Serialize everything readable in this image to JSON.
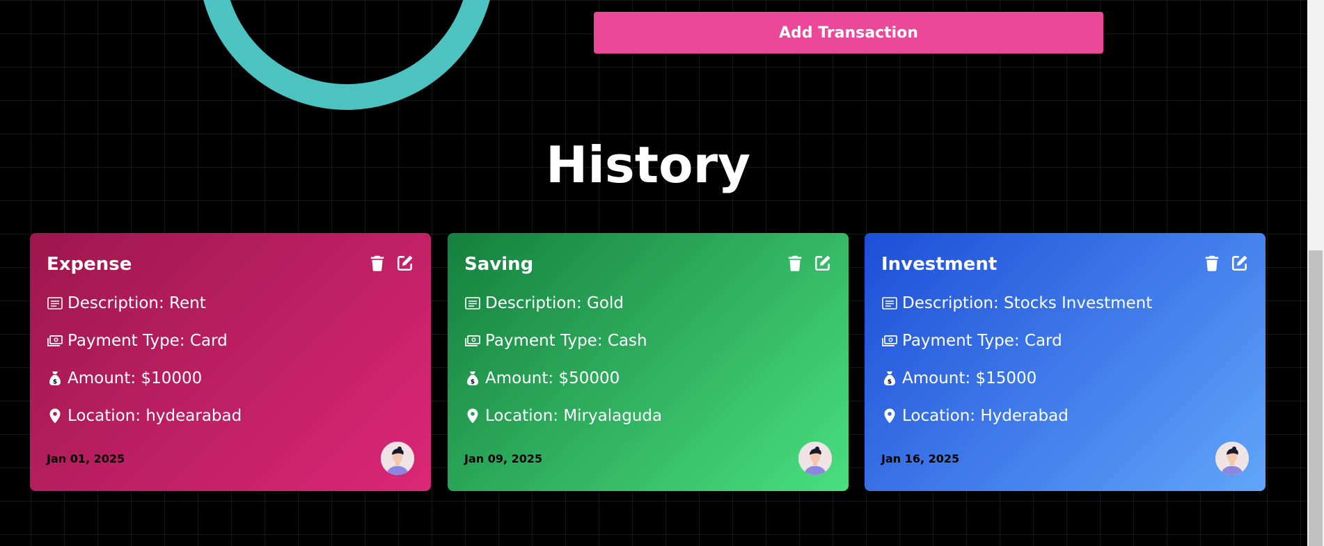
{
  "add_button": {
    "label": "Add Transaction"
  },
  "history": {
    "title": "History",
    "cards": [
      {
        "category": "Expense",
        "description": "Description: Rent",
        "payment_type": "Payment Type: Card",
        "amount": "Amount: $10000",
        "location": "Location: hydearabad",
        "date": "Jan 01, 2025"
      },
      {
        "category": "Saving",
        "description": "Description: Gold",
        "payment_type": "Payment Type: Cash",
        "amount": "Amount: $50000",
        "location": "Location: Miryalaguda",
        "date": "Jan 09, 2025"
      },
      {
        "category": "Investment",
        "description": "Description: Stocks Investment",
        "payment_type": "Payment Type: Card",
        "amount": "Amount: $15000",
        "location": "Location: Hyderabad",
        "date": "Jan 16, 2025"
      }
    ]
  },
  "icons": {
    "actions": [
      "trash-icon",
      "edit-icon"
    ],
    "rows": [
      "description-icon",
      "payment-icon",
      "money-bag-icon",
      "location-pin-icon"
    ]
  },
  "colors": {
    "background": "#000000",
    "ring": "#4cc2c1",
    "add_button": "#ec4899",
    "expense": [
      "#9d174d",
      "#db2777"
    ],
    "saving": [
      "#15803d",
      "#4ade80"
    ],
    "investment": [
      "#1d4ed8",
      "#60a5fa"
    ]
  }
}
